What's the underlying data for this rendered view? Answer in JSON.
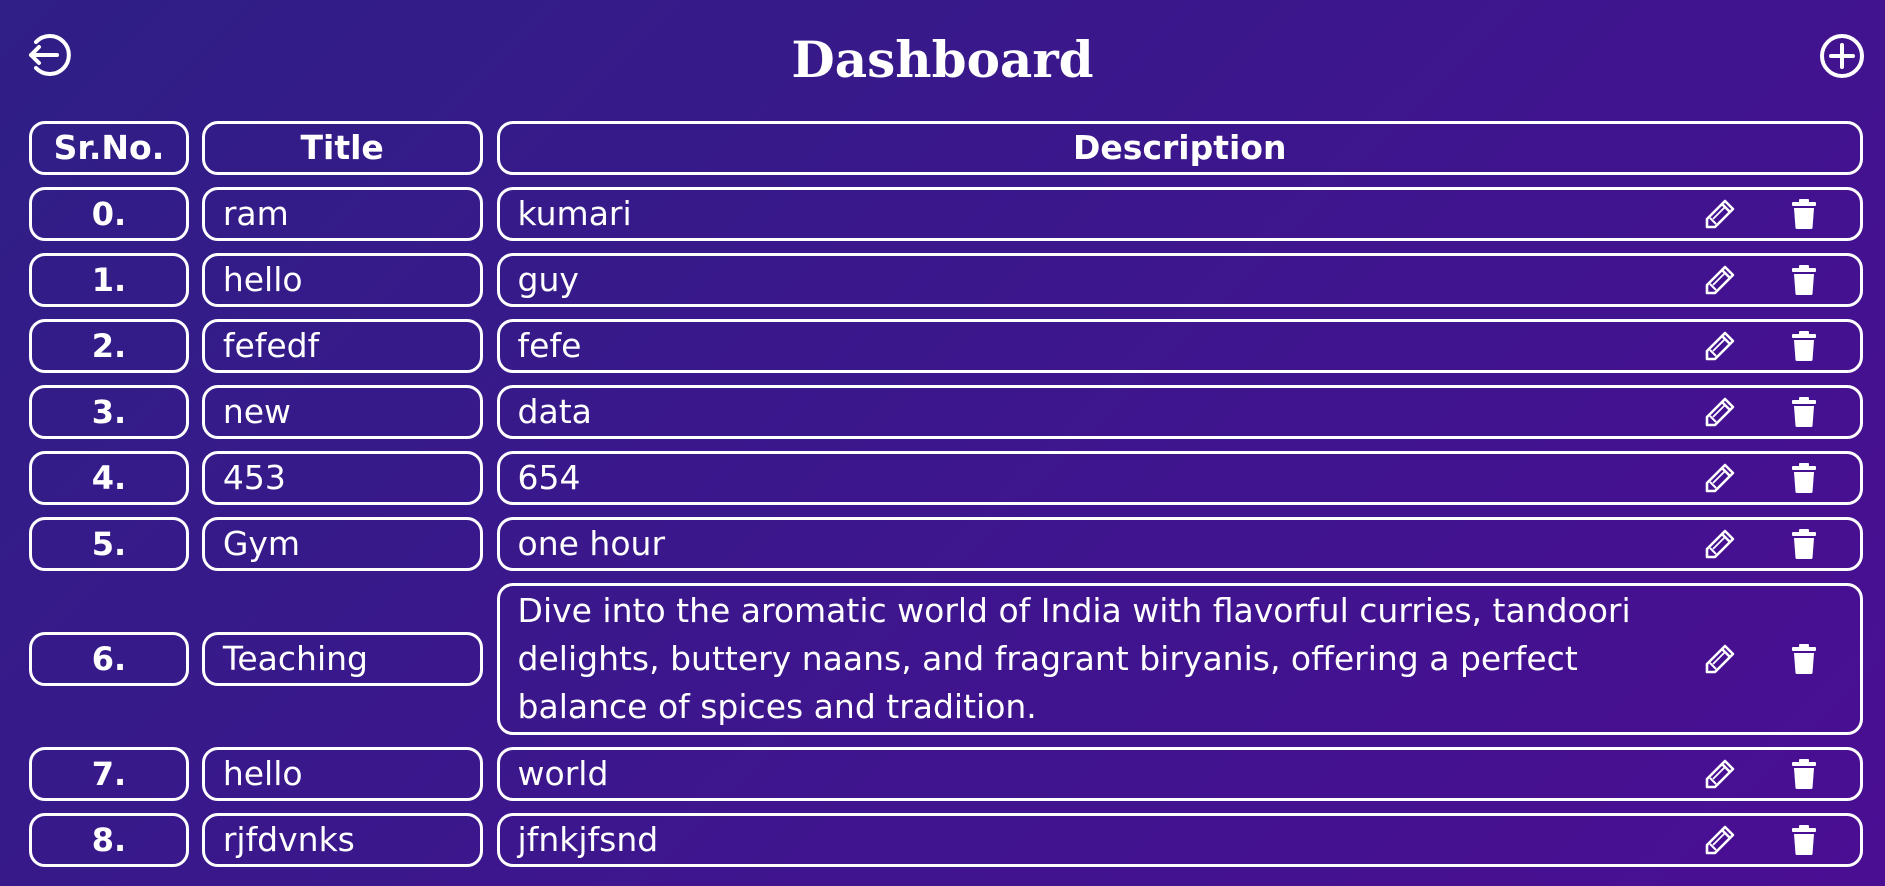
{
  "header": {
    "title": "Dashboard",
    "logout_icon": "logout-circle-arrow-icon",
    "add_icon": "plus-circle-icon"
  },
  "table": {
    "columns": [
      "Sr.No.",
      "Title",
      "Description"
    ],
    "rows": [
      {
        "sr": "0.",
        "title": "ram",
        "description": "kumari"
      },
      {
        "sr": "1.",
        "title": "hello",
        "description": "guy"
      },
      {
        "sr": "2.",
        "title": "fefedf",
        "description": "fefe"
      },
      {
        "sr": "3.",
        "title": "new",
        "description": "data"
      },
      {
        "sr": "4.",
        "title": "453",
        "description": "654"
      },
      {
        "sr": "5.",
        "title": "Gym",
        "description": "one hour"
      },
      {
        "sr": "6.",
        "title": "Teaching",
        "description": "Dive into the aromatic world of India with flavorful curries, tandoori delights, buttery naans, and fragrant biryanis, offering a perfect balance of spices and tradition."
      },
      {
        "sr": "7.",
        "title": "hello",
        "description": "world"
      },
      {
        "sr": "8.",
        "title": "rjfdvnks",
        "description": "jfnkjfsnd"
      }
    ],
    "row_action_icons": [
      "pencil-icon",
      "trash-icon"
    ]
  },
  "colors": {
    "background_start": "#2f1f86",
    "background_end": "#4a0e93",
    "foreground": "#ffffff"
  }
}
